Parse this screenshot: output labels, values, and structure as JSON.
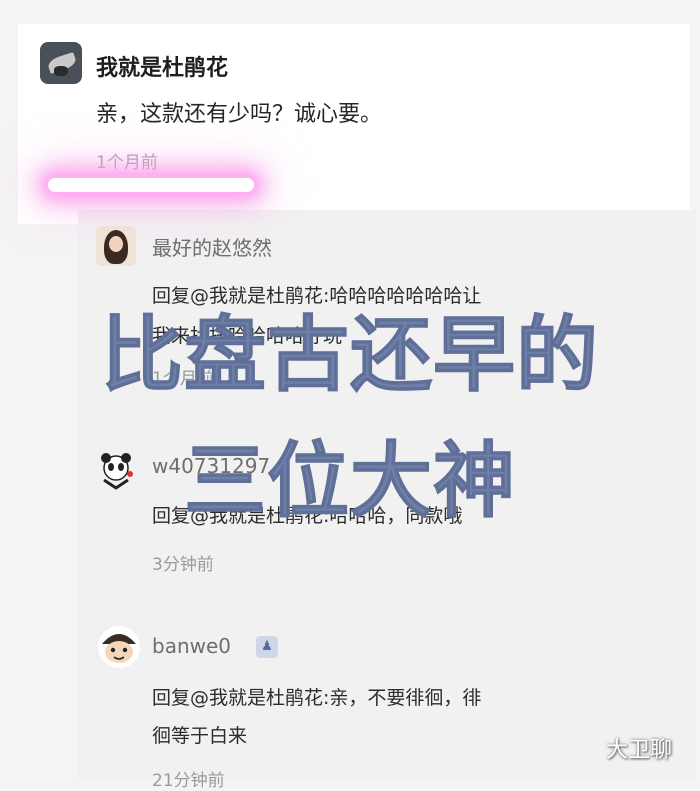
{
  "top_fragment": "",
  "post": {
    "username": "我就是杜鹃花",
    "comment": "亲，这款还有少吗？诚心要。",
    "time": "1个月前"
  },
  "replies": [
    {
      "username": "最好的赵悠然",
      "line1": "回复@我就是杜鹃花:哈哈哈哈哈哈哈让",
      "line2": "我来找托哈哈哈哈好玩",
      "time": "1个月前"
    },
    {
      "username": "w40731297",
      "line1": "回复@我就是杜鹃花:哈哈哈，同款哦",
      "time": "3分钟前"
    },
    {
      "username": "banwe0",
      "line1": "回复@我就是杜鹃花:亲，不要徘徊，徘",
      "line2": "徊等于白来",
      "time": "21分钟前"
    }
  ],
  "overlay": {
    "line1": "比盘古还早的",
    "line2": "三位大神"
  },
  "watermark": "大卫聊",
  "colors": {
    "overlay_text": "#6e7fa8",
    "highlight_glow": "#ff9fe8"
  }
}
